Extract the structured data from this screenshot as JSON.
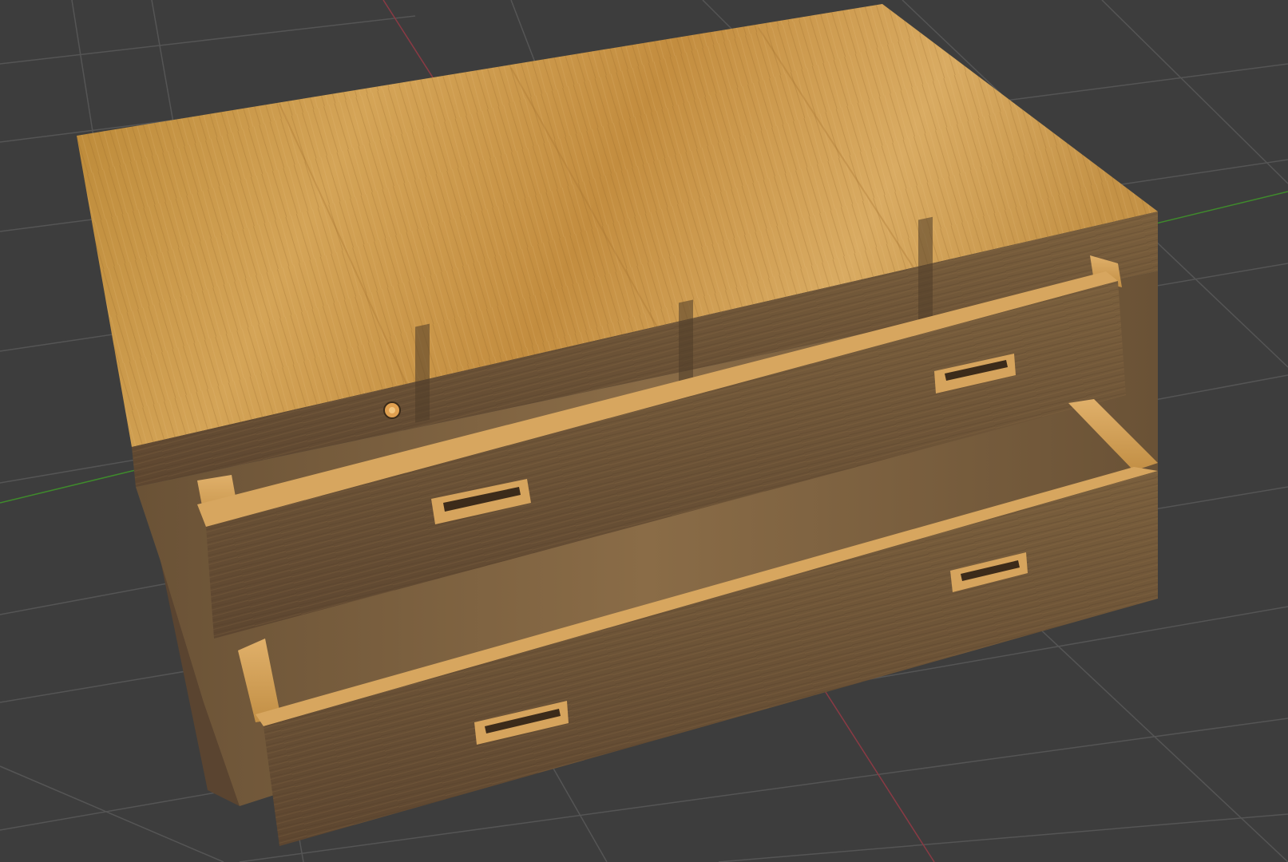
{
  "viewport": {
    "background_color": "#3d3d3d",
    "grid_color": "#545454",
    "x_axis_color": "#8a3a44",
    "y_axis_color": "#3f8a2c",
    "origin_marker_color": "#e0a050"
  },
  "object": {
    "kind": "wooden-drawer-chest",
    "material": "light-wood",
    "top_color": "#c8953e",
    "front_color": "#6e5536",
    "drawer_count": 2,
    "handle_icon": "drawer-pull-handle-icon"
  }
}
